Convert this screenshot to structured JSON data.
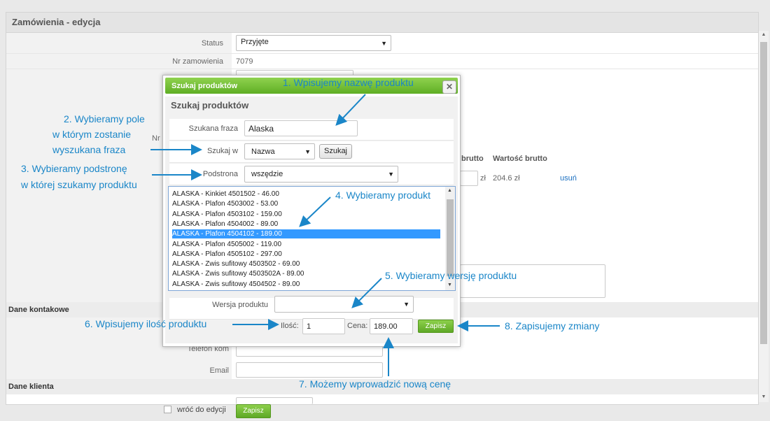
{
  "page": {
    "title": "Zamówienia - edycja",
    "fields": {
      "status_label": "Status",
      "status_value": "Przyjęte",
      "order_no_label": "Nr zamowienia",
      "order_no_value": "7079",
      "nr_partial_label": "Nr"
    },
    "table_headers": {
      "gross": "brutto",
      "gross_value": "Wartość brutto"
    },
    "row": {
      "unit": "zł",
      "gross_value": "204.6 zł",
      "remove": "usuń"
    },
    "sections": {
      "contact": "Dane kontakowe",
      "client": "Dane klienta"
    },
    "contact_fields": {
      "phone": "Telefon kom",
      "email": "Email"
    },
    "footer": {
      "return_label": "wróć do edycji",
      "save_label": "Zapisz"
    }
  },
  "modal": {
    "title": "Szukaj produktów",
    "close_icon": "close-icon",
    "heading": "Szukaj produktów",
    "search_phrase_label": "Szukana fraza",
    "search_phrase_value": "Alaska",
    "search_in_label": "Szukaj w",
    "search_in_value": "Nazwa",
    "search_button": "Szukaj",
    "subpage_label": "Podstrona",
    "subpage_value": "wszędzie",
    "products": [
      "ALASKA - Kinkiet 4501502 - 46.00",
      "ALASKA - Plafon 4503002 - 53.00",
      "ALASKA - Plafon 4503102 - 159.00",
      "ALASKA - Plafon 4504002 - 89.00",
      "ALASKA - Plafon 4504102 - 189.00",
      "ALASKA - Plafon 4505002 - 119.00",
      "ALASKA - Plafon 4505102 - 297.00",
      "ALASKA - Zwis sufitowy 4503502 - 69.00",
      "ALASKA - Zwis sufitowy 4503502A - 89.00",
      "ALASKA - Zwis sufitowy 4504502 - 89.00"
    ],
    "selected_index": 4,
    "version_label": "Wersja produktu",
    "version_value": "",
    "quantity_label": "Ilość:",
    "quantity_value": "1",
    "price_label": "Cena:",
    "price_value": "189.00",
    "save_button": "Zapisz"
  },
  "annotations": {
    "a1": "1. Wpisujemy nazwę produktu",
    "a2_line1": "2. Wybieramy pole",
    "a2_line2": "w którym zostanie",
    "a2_line3": "wyszukana fraza",
    "a3_line1": "3. Wybieramy podstronę",
    "a3_line2": "w której szukamy produktu",
    "a4": "4. Wybieramy produkt",
    "a5": "5. Wybieramy wersję produktu",
    "a6": "6. Wpisujemy ilość produktu",
    "a7": "7. Możemy wprowadzić nową cenę",
    "a8": "8. Zapisujemy zmiany"
  },
  "colors": {
    "accent_green": "#6cb52f",
    "annotation_blue": "#1a86c8",
    "selection_blue": "#3399ff"
  }
}
